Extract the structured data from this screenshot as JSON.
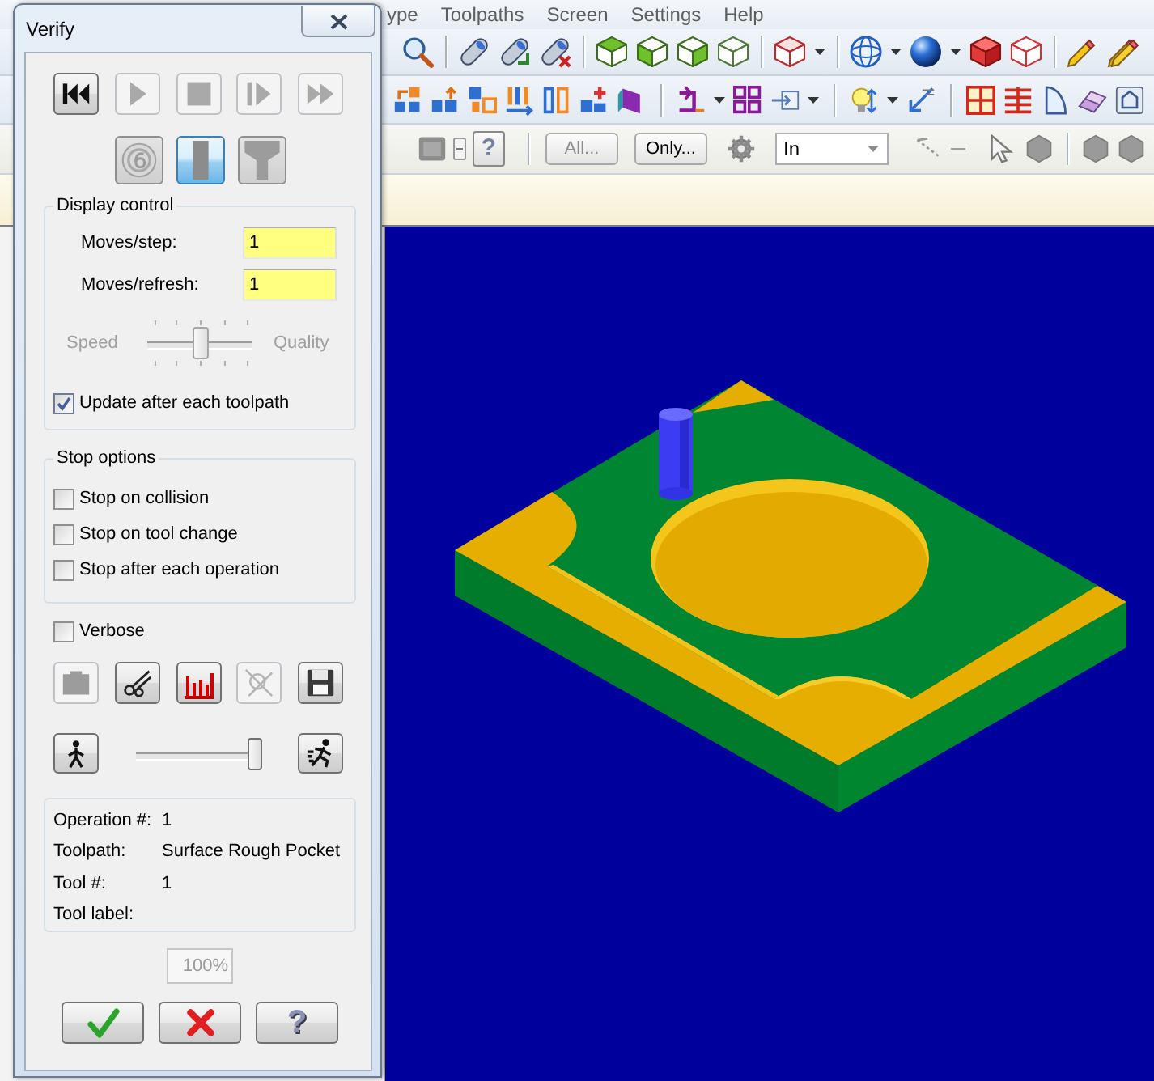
{
  "app": {
    "menu": [
      "ype",
      "Toolpaths",
      "Screen",
      "Settings",
      "Help"
    ],
    "toolbar": {
      "help_button": "?",
      "all_button": {
        "text": "All...",
        "disabled": true
      },
      "only_button": {
        "text": "Only...",
        "disabled": false
      },
      "mask_combo": "In"
    }
  },
  "dialog": {
    "title": "Verify",
    "playback_buttons": [
      {
        "kind": "rewind",
        "disabled": false
      },
      {
        "kind": "play",
        "disabled": true
      },
      {
        "kind": "stop",
        "disabled": true
      },
      {
        "kind": "step",
        "disabled": true
      },
      {
        "kind": "fast_forward",
        "disabled": true
      }
    ],
    "display_modes": [
      {
        "kind": "disc",
        "selected": false
      },
      {
        "kind": "bar",
        "selected": true
      },
      {
        "kind": "funnel",
        "selected": false
      }
    ],
    "display_control": {
      "legend": "Display control",
      "fields": [
        {
          "label": "Moves/step:",
          "value": "1"
        },
        {
          "label": "Moves/refresh:",
          "value": "1"
        }
      ],
      "slider": {
        "left_label": "Speed",
        "right_label": "Quality",
        "level": 0.5,
        "disabled": true
      },
      "update_checkbox": {
        "label": "Update after each toolpath",
        "checked": true
      }
    },
    "stop_options": {
      "legend": "Stop options",
      "checkboxes": [
        {
          "label": "Stop on collision",
          "checked": false
        },
        {
          "label": "Stop on tool change",
          "checked": false
        },
        {
          "label": "Stop after each operation",
          "checked": false
        }
      ]
    },
    "verbose": {
      "label": "Verbose",
      "checked": false
    },
    "tool_buttons": [
      {
        "kind": "block",
        "disabled": true
      },
      {
        "kind": "cutter",
        "disabled": false
      },
      {
        "kind": "chart",
        "disabled": false
      },
      {
        "kind": "crossed",
        "disabled": true
      },
      {
        "kind": "save",
        "disabled": false
      }
    ],
    "speed_slider": {
      "level": 1
    },
    "info": [
      {
        "label": "Operation #:",
        "value": "1"
      },
      {
        "label": "Toolpath:",
        "value": "Surface Rough Pocket"
      },
      {
        "label": "Tool #:",
        "value": "1"
      },
      {
        "label": "Tool label:"
      }
    ],
    "progress": {
      "text": "100%",
      "disabled": true
    },
    "footer_buttons": [
      {
        "kind": "ok"
      },
      {
        "kind": "cancel"
      },
      {
        "kind": "help",
        "text": "?"
      }
    ]
  }
}
